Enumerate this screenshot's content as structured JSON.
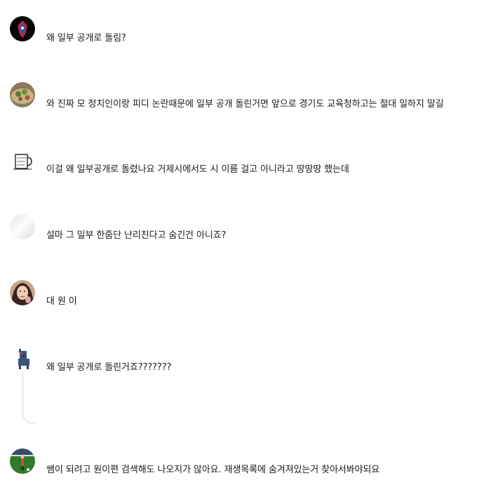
{
  "comments": [
    {
      "avatar": "spider-hero-avatar",
      "text": "왜 일부 공개로 돌림?"
    },
    {
      "avatar": "food-plate-avatar",
      "text": "와 진짜 모 정치인이랑 피디 논란때문에 일부 공개 돌린거면 앞으로 경기도 교육청하고는 절대 일하지 말길"
    },
    {
      "avatar": "mug-sketch-avatar",
      "text": "이걸 왜 일부공개로 돌렸나요 거제시에서도 시 이름 걸고 아니라고 땅땅땅 했는데"
    },
    {
      "avatar": "default-gray-avatar",
      "text": "설마 그 일부 한줌단 난리친다고 숨긴건 아니죠?"
    },
    {
      "avatar": "person-photo-avatar",
      "text": "대 원 이"
    },
    {
      "avatar": "alpaca-avatar",
      "text": "왜 일부 공개로 돌린거죠???????"
    },
    {
      "avatar": "soccer-field-avatar",
      "text": "쌤이 되려고 원이편 검색해도 나오지가 않아요. 재생목록에 숨겨져있는거 찾아서봐야되요"
    }
  ],
  "colors": {
    "text": "#1a1a1a",
    "thread_line": "#d9d9d9"
  }
}
